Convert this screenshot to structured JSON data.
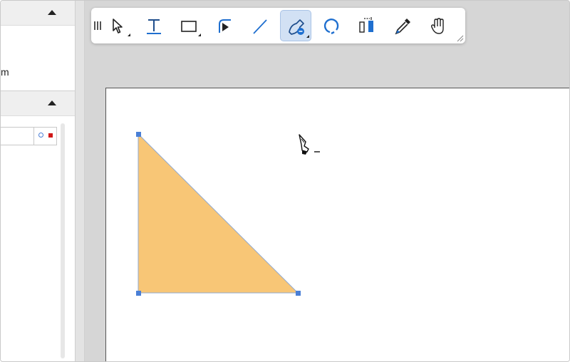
{
  "left_panel": {
    "partial_text": "m",
    "header_top_action": "collapse",
    "header_bottom_action": "collapse"
  },
  "toolbar": {
    "tools": [
      {
        "name": "select-tool",
        "icon": "arrow-pointer-icon",
        "active": false
      },
      {
        "name": "text-tool",
        "icon": "text-t-icon",
        "active": false
      },
      {
        "name": "rectangle-tool",
        "icon": "rectangle-icon",
        "active": false
      },
      {
        "name": "connector-tool",
        "icon": "curve-corner-icon",
        "active": false
      },
      {
        "name": "line-tool",
        "icon": "line-icon",
        "active": false
      },
      {
        "name": "pen-tool",
        "icon": "pen-nib-icon",
        "active": true
      },
      {
        "name": "lasso-tool",
        "icon": "lasso-icon",
        "active": false
      },
      {
        "name": "align-tool",
        "icon": "align-bars-icon",
        "active": false
      },
      {
        "name": "eyedropper-tool",
        "icon": "eyedropper-icon",
        "active": false
      },
      {
        "name": "hand-tool",
        "icon": "hand-icon",
        "active": false
      }
    ]
  },
  "colors": {
    "shape_fill": "#f8c676",
    "shape_stroke": "#8fa9d1",
    "handle": "#4a7fd6",
    "accent": "#1f6fcf",
    "active_tool_bg": "#d2e1f4"
  },
  "shape": {
    "type": "right-triangle",
    "selected": true
  },
  "cursor": {
    "icon": "pen-remove-point-cursor"
  }
}
